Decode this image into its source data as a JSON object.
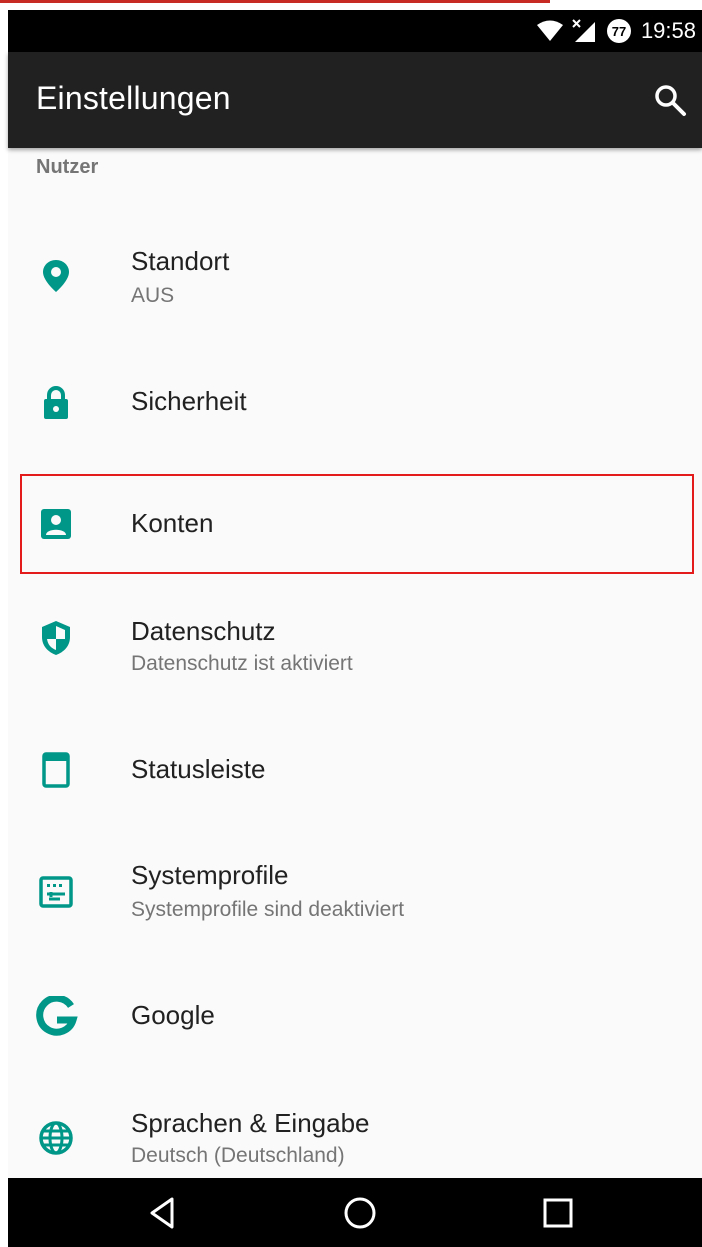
{
  "status_bar": {
    "time": "19:58",
    "notification_badge": "77",
    "icons": [
      "wifi-icon",
      "signal-icon",
      "notification-badge-icon"
    ]
  },
  "toolbar": {
    "title": "Einstellungen",
    "search_icon": "search-icon"
  },
  "section": {
    "header": "Nutzer"
  },
  "items": [
    {
      "label": "Standort",
      "subtitle": "AUS",
      "icon": "location-icon"
    },
    {
      "label": "Sicherheit",
      "subtitle": "",
      "icon": "lock-icon"
    },
    {
      "label": "Konten",
      "subtitle": "",
      "icon": "account-icon",
      "highlighted": true
    },
    {
      "label": "Datenschutz",
      "subtitle": "Datenschutz ist aktiviert",
      "icon": "shield-icon"
    },
    {
      "label": "Statusleiste",
      "subtitle": "",
      "icon": "statusbar-icon"
    },
    {
      "label": "Systemprofile",
      "subtitle": "Systemprofile sind deaktiviert",
      "icon": "system-profiles-icon"
    },
    {
      "label": "Google",
      "subtitle": "",
      "icon": "google-icon"
    },
    {
      "label": "Sprachen & Eingabe",
      "subtitle": "Deutsch (Deutschland)",
      "icon": "globe-icon"
    }
  ],
  "nav_bar": {
    "buttons": [
      "back-icon",
      "home-icon",
      "recents-icon"
    ]
  },
  "colors": {
    "accent": "#009688",
    "toolbar": "#212121",
    "status_bar": "#000000",
    "background": "#fafafa",
    "highlight": "#e31b1b"
  }
}
